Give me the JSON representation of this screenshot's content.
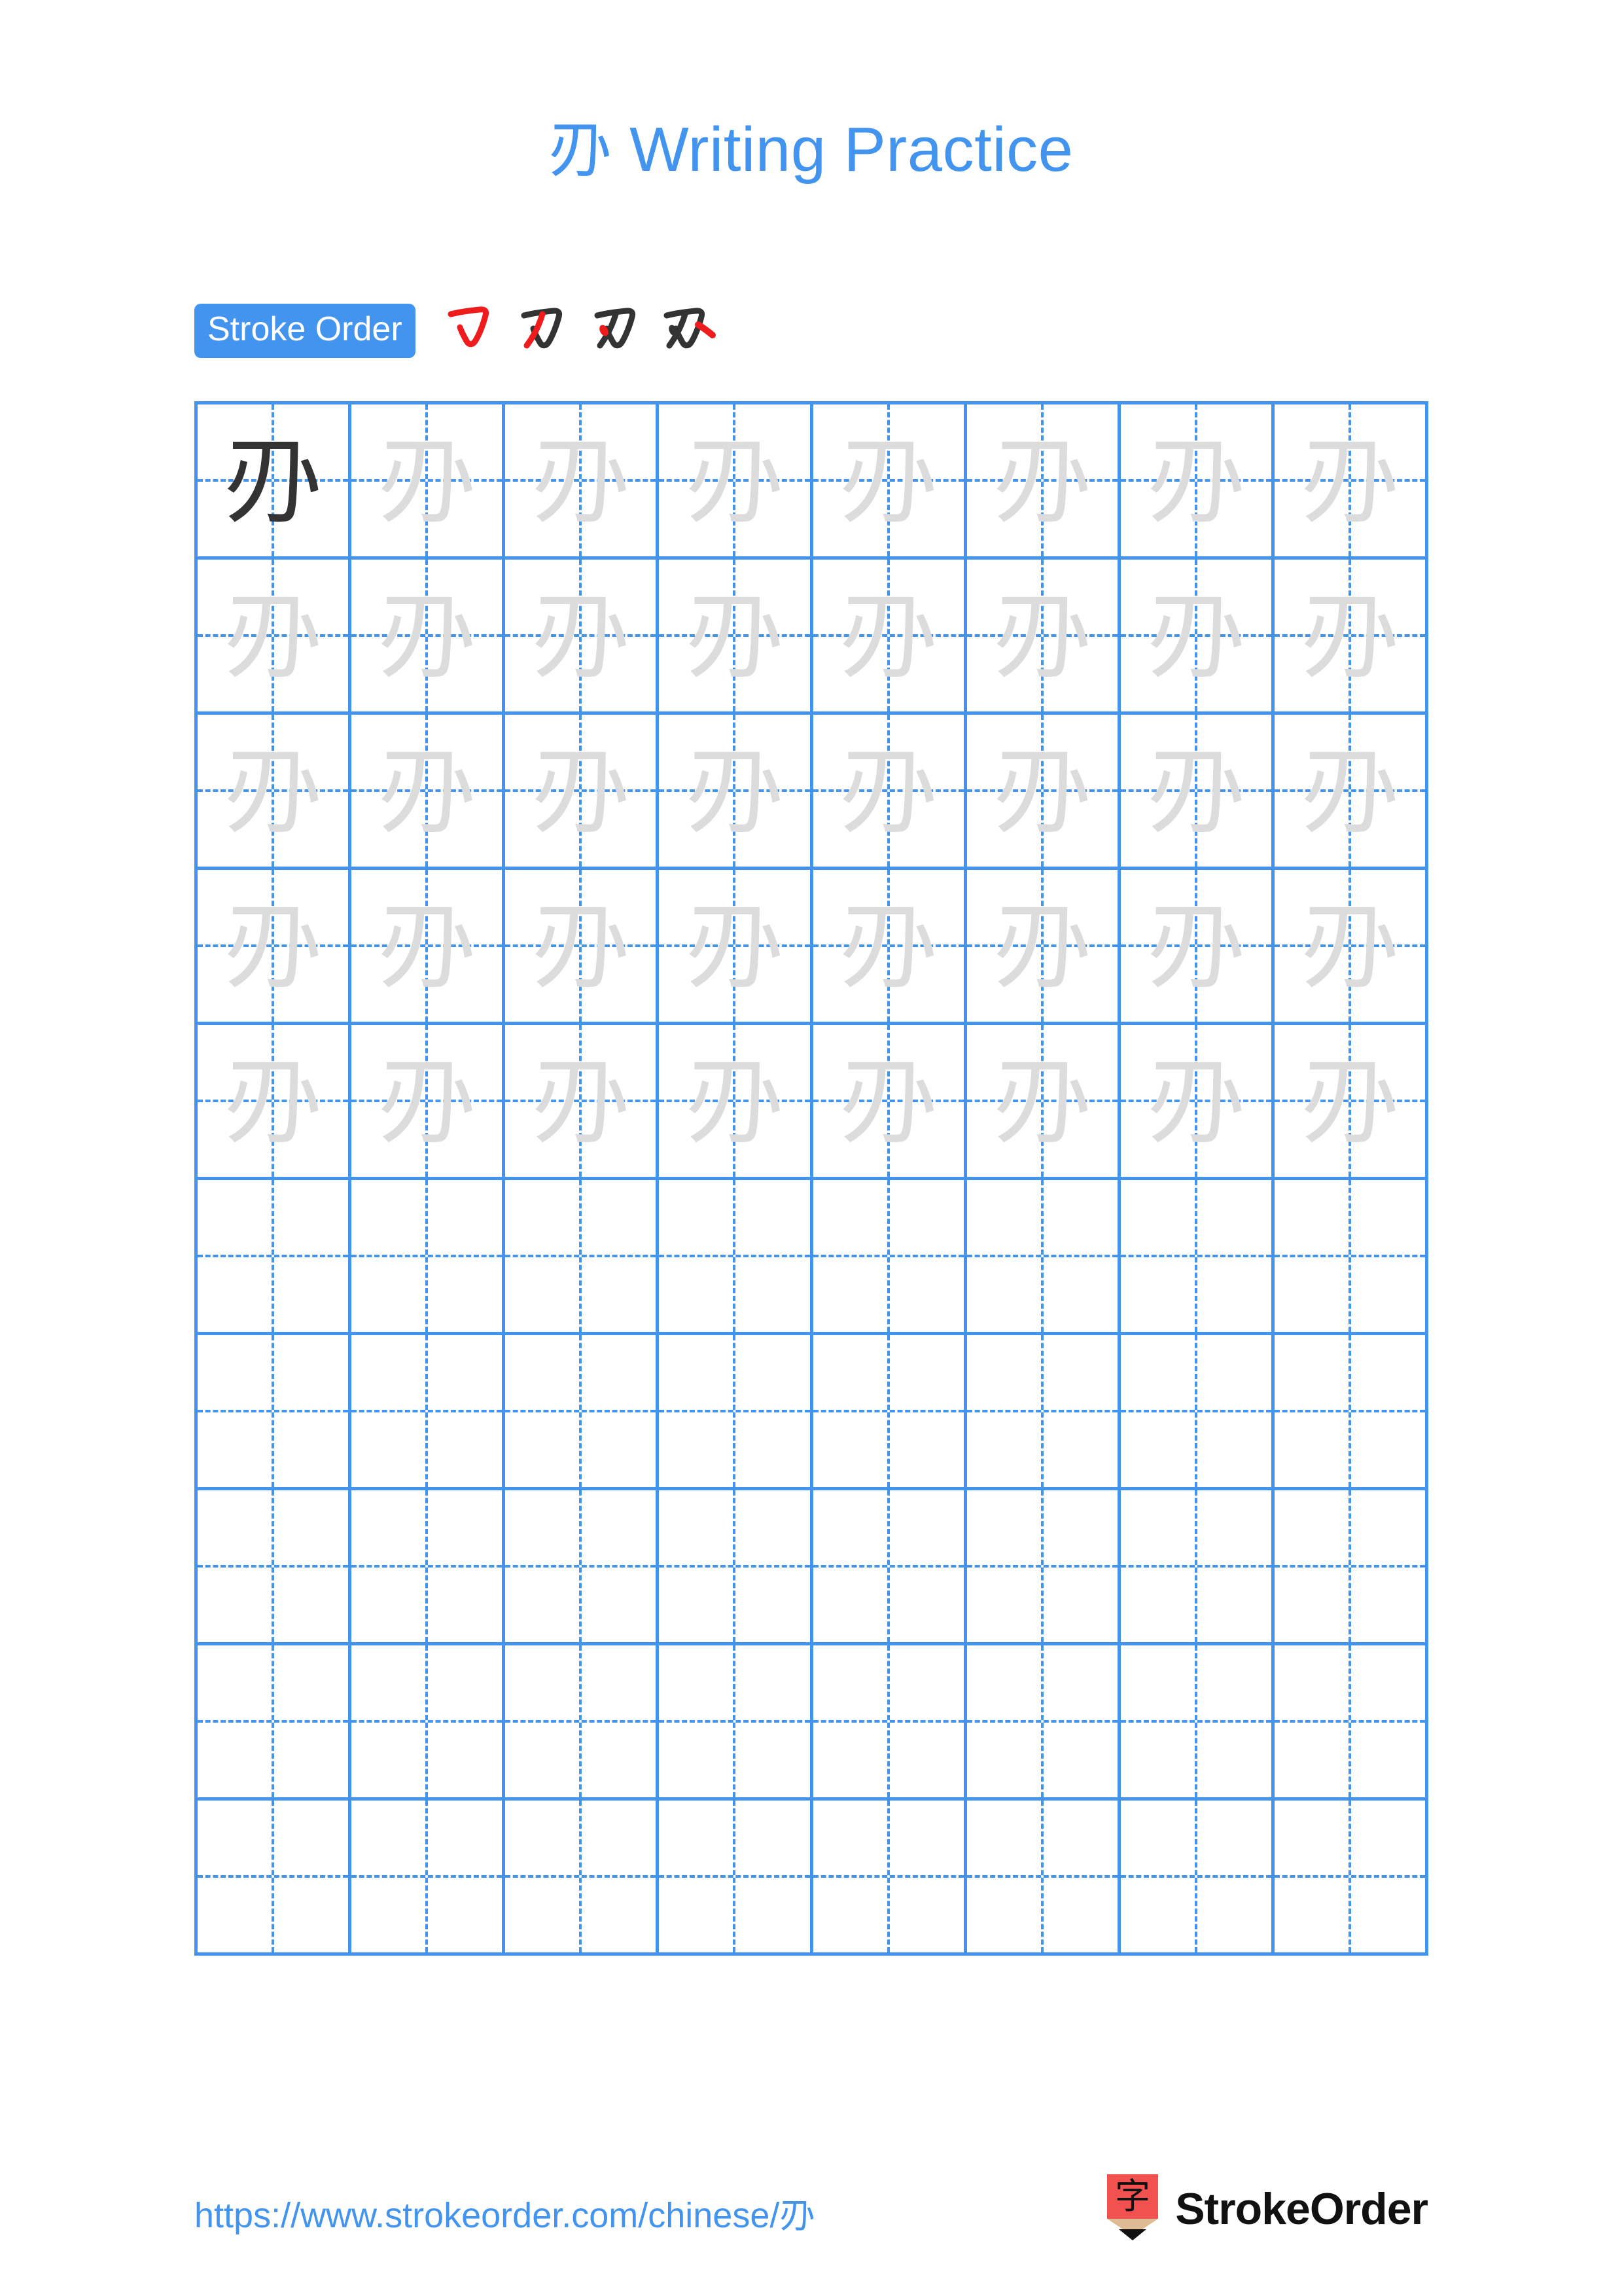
{
  "page": {
    "character": "刅",
    "title_suffix": " Writing Practice",
    "accent_color": "#4294ef",
    "ghost_color": "#dcdcdc",
    "ink_color": "#333333",
    "highlight_color": "#ee1c1c"
  },
  "stroke_order": {
    "label": "Stroke Order",
    "stroke_count": 4,
    "steps": [
      {
        "index": 1,
        "name": "horizontal-fold-hook"
      },
      {
        "index": 2,
        "name": "left-falling-stroke"
      },
      {
        "index": 3,
        "name": "dot-stroke"
      },
      {
        "index": 4,
        "name": "right-falling-stroke"
      }
    ]
  },
  "grid": {
    "columns": 8,
    "rows": 10,
    "filled_rows": 5,
    "empty_rows": 5,
    "first_cell_style": "ink",
    "tracing_style": "ghost"
  },
  "footer": {
    "url": "https://www.strokeorder.com/chinese/刅",
    "brand_name": "StrokeOrder",
    "brand_glyph": "字"
  }
}
